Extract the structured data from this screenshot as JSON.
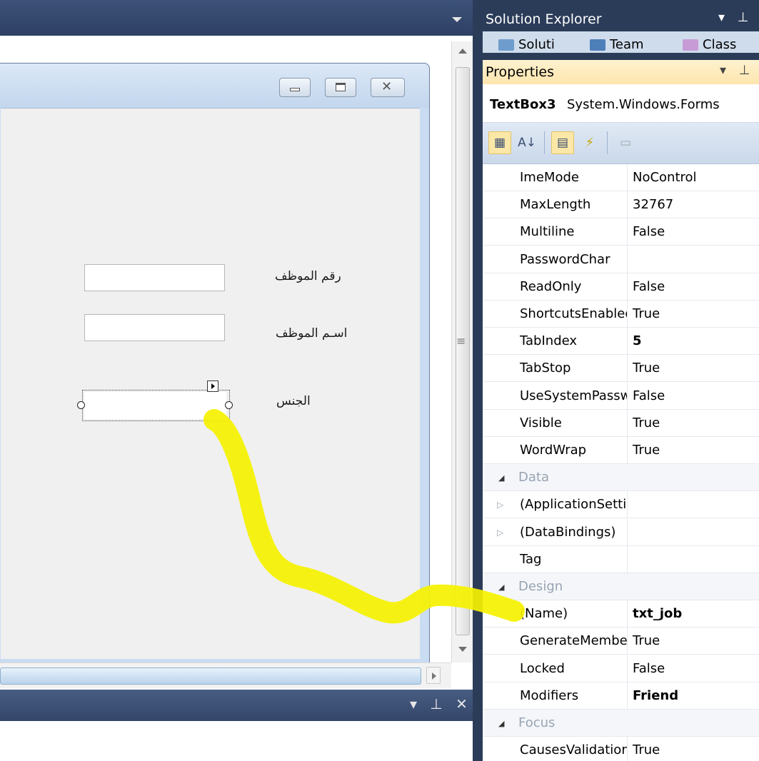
{
  "solution_explorer": {
    "title": "Solution Explorer",
    "tabs": [
      {
        "label": "Soluti",
        "icon": "solution-icon"
      },
      {
        "label": "Team",
        "icon": "team-icon"
      },
      {
        "label": "Class",
        "icon": "class-view-icon"
      }
    ]
  },
  "properties": {
    "title": "Properties",
    "object_name": "TextBox3",
    "object_type": "System.Windows.Forms",
    "toolbar": [
      {
        "name": "categorized-icon",
        "active": true
      },
      {
        "name": "alphabetical-icon",
        "active": false
      },
      {
        "name": "properties-icon",
        "active": true
      },
      {
        "name": "events-icon",
        "active": false
      },
      {
        "name": "property-pages-icon",
        "active": false
      }
    ],
    "rows": [
      {
        "kind": "prop",
        "name": "ImeMode",
        "value": "NoControl"
      },
      {
        "kind": "prop",
        "name": "MaxLength",
        "value": "32767"
      },
      {
        "kind": "prop",
        "name": "Multiline",
        "value": "False"
      },
      {
        "kind": "prop",
        "name": "PasswordChar",
        "value": ""
      },
      {
        "kind": "prop",
        "name": "ReadOnly",
        "value": "False"
      },
      {
        "kind": "prop",
        "name": "ShortcutsEnabled",
        "value": "True"
      },
      {
        "kind": "prop",
        "name": "TabIndex",
        "value": "5",
        "bold": true
      },
      {
        "kind": "prop",
        "name": "TabStop",
        "value": "True"
      },
      {
        "kind": "prop",
        "name": "UseSystemPasswordChar",
        "value": "False"
      },
      {
        "kind": "prop",
        "name": "Visible",
        "value": "True"
      },
      {
        "kind": "prop",
        "name": "WordWrap",
        "value": "True"
      },
      {
        "kind": "category",
        "name": "Data"
      },
      {
        "kind": "prop",
        "name": "(ApplicationSettings)",
        "value": "",
        "expandable": true
      },
      {
        "kind": "prop",
        "name": "(DataBindings)",
        "value": "",
        "expandable": true
      },
      {
        "kind": "prop",
        "name": "Tag",
        "value": ""
      },
      {
        "kind": "category",
        "name": "Design"
      },
      {
        "kind": "prop",
        "name": "(Name)",
        "value": "txt_job",
        "bold": true
      },
      {
        "kind": "prop",
        "name": "GenerateMember",
        "value": "True"
      },
      {
        "kind": "prop",
        "name": "Locked",
        "value": "False"
      },
      {
        "kind": "prop",
        "name": "Modifiers",
        "value": "Friend",
        "bold": true
      },
      {
        "kind": "category",
        "name": "Focus"
      },
      {
        "kind": "prop",
        "name": "CausesValidation",
        "value": "True"
      }
    ]
  },
  "form": {
    "labels": {
      "employee_number": "رقم الموظف",
      "employee_name": "اسـم الموظف",
      "gender": "الجنس"
    }
  },
  "colors": {
    "ide_background": "#2b3c59",
    "properties_title": "#fde5ad",
    "annotation": "#f5f200"
  }
}
